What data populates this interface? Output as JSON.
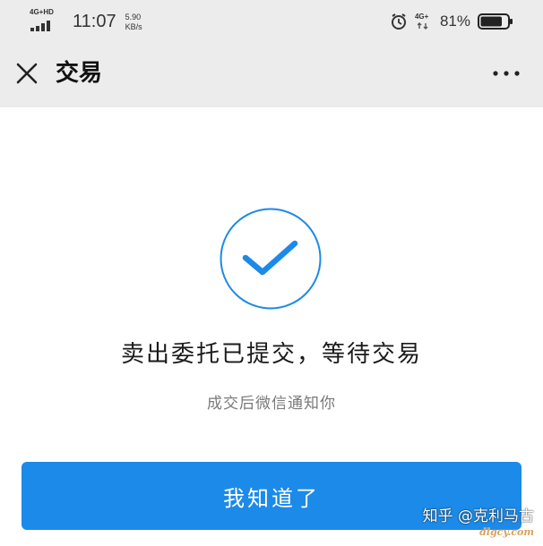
{
  "status_bar": {
    "network_type": "4G+HD",
    "time": "11:07",
    "speed_value": "5.90",
    "speed_unit": "KB/s",
    "network_type_right": "4G+",
    "battery_percent": "81%",
    "battery_level": 0.81,
    "icons": [
      "signal-icon",
      "alarm-icon",
      "mobile-data-icon",
      "battery-icon"
    ]
  },
  "nav": {
    "title": "交易",
    "close_icon": "close-icon",
    "more_icon": "more-icon"
  },
  "content": {
    "status_icon": "check-circle-icon",
    "message": "卖出委托已提交，等待交易",
    "sub_message": "成交后微信通知你",
    "confirm_label": "我知道了"
  },
  "watermark": {
    "text": "知乎 @克利马古",
    "url": "dlgcy.com"
  },
  "colors": {
    "accent": "#1c8ae8",
    "bar_background": "#ececec",
    "page_background": "#ffffff"
  }
}
